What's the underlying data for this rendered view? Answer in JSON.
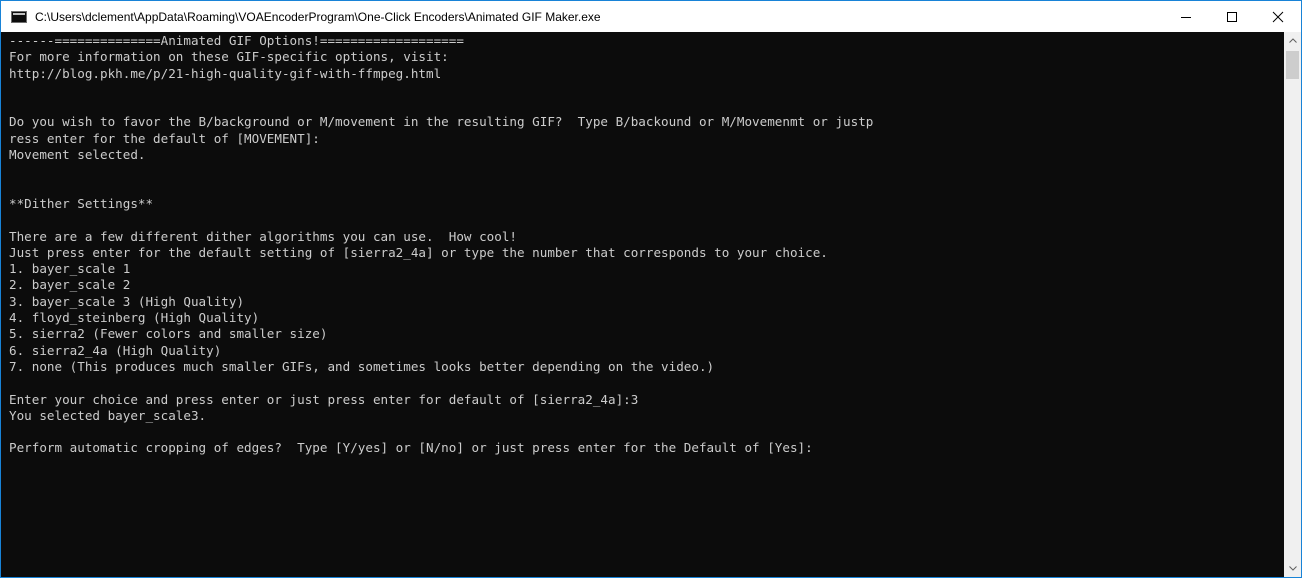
{
  "window": {
    "title": "C:\\Users\\dclement\\AppData\\Roaming\\VOAEncoderProgram\\One-Click Encoders\\Animated GIF Maker.exe",
    "app_icon": "console-icon",
    "controls": {
      "minimize_icon": "minimize-icon",
      "maximize_icon": "maximize-icon",
      "close_icon": "close-icon"
    }
  },
  "console": {
    "background": "#0c0c0c",
    "text_color": "#cccccc",
    "lines": [
      "------==============Animated GIF Options!===================",
      "For more information on these GIF-specific options, visit:",
      "http://blog.pkh.me/p/21-high-quality-gif-with-ffmpeg.html",
      "",
      "",
      "Do you wish to favor the B/background or M/movement in the resulting GIF?  Type B/backound or M/Movemenmt or justp",
      "ress enter for the default of [MOVEMENT]:",
      "Movement selected.",
      "",
      "",
      "**Dither Settings**",
      "",
      "There are a few different dither algorithms you can use.  How cool!",
      "Just press enter for the default setting of [sierra2_4a] or type the number that corresponds to your choice.",
      "1. bayer_scale 1",
      "2. bayer_scale 2",
      "3. bayer_scale 3 (High Quality)",
      "4. floyd_steinberg (High Quality)",
      "5. sierra2 (Fewer colors and smaller size)",
      "6. sierra2_4a (High Quality)",
      "7. none (This produces much smaller GIFs, and sometimes looks better depending on the video.)",
      "",
      "Enter your choice and press enter or just press enter for default of [sierra2_4a]:3",
      "You selected bayer_scale3.",
      "",
      "Perform automatic cropping of edges?  Type [Y/yes] or [N/no] or just press enter for the Default of [Yes]:"
    ]
  },
  "scrollbar": {
    "up_icon": "scroll-up-arrow-icon",
    "down_icon": "scroll-down-arrow-icon"
  }
}
